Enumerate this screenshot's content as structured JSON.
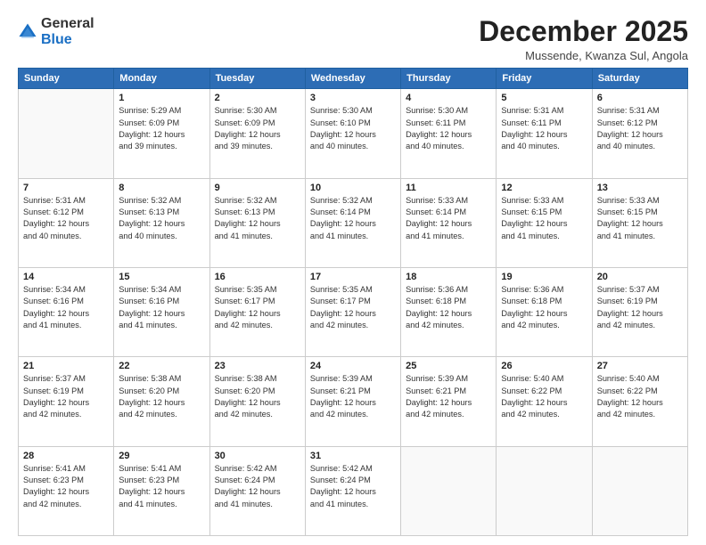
{
  "logo": {
    "general": "General",
    "blue": "Blue"
  },
  "header": {
    "month": "December 2025",
    "location": "Mussende, Kwanza Sul, Angola"
  },
  "days_of_week": [
    "Sunday",
    "Monday",
    "Tuesday",
    "Wednesday",
    "Thursday",
    "Friday",
    "Saturday"
  ],
  "weeks": [
    [
      {
        "day": "",
        "info": ""
      },
      {
        "day": "1",
        "info": "Sunrise: 5:29 AM\nSunset: 6:09 PM\nDaylight: 12 hours\nand 39 minutes."
      },
      {
        "day": "2",
        "info": "Sunrise: 5:30 AM\nSunset: 6:09 PM\nDaylight: 12 hours\nand 39 minutes."
      },
      {
        "day": "3",
        "info": "Sunrise: 5:30 AM\nSunset: 6:10 PM\nDaylight: 12 hours\nand 40 minutes."
      },
      {
        "day": "4",
        "info": "Sunrise: 5:30 AM\nSunset: 6:11 PM\nDaylight: 12 hours\nand 40 minutes."
      },
      {
        "day": "5",
        "info": "Sunrise: 5:31 AM\nSunset: 6:11 PM\nDaylight: 12 hours\nand 40 minutes."
      },
      {
        "day": "6",
        "info": "Sunrise: 5:31 AM\nSunset: 6:12 PM\nDaylight: 12 hours\nand 40 minutes."
      }
    ],
    [
      {
        "day": "7",
        "info": "Sunrise: 5:31 AM\nSunset: 6:12 PM\nDaylight: 12 hours\nand 40 minutes."
      },
      {
        "day": "8",
        "info": "Sunrise: 5:32 AM\nSunset: 6:13 PM\nDaylight: 12 hours\nand 40 minutes."
      },
      {
        "day": "9",
        "info": "Sunrise: 5:32 AM\nSunset: 6:13 PM\nDaylight: 12 hours\nand 41 minutes."
      },
      {
        "day": "10",
        "info": "Sunrise: 5:32 AM\nSunset: 6:14 PM\nDaylight: 12 hours\nand 41 minutes."
      },
      {
        "day": "11",
        "info": "Sunrise: 5:33 AM\nSunset: 6:14 PM\nDaylight: 12 hours\nand 41 minutes."
      },
      {
        "day": "12",
        "info": "Sunrise: 5:33 AM\nSunset: 6:15 PM\nDaylight: 12 hours\nand 41 minutes."
      },
      {
        "day": "13",
        "info": "Sunrise: 5:33 AM\nSunset: 6:15 PM\nDaylight: 12 hours\nand 41 minutes."
      }
    ],
    [
      {
        "day": "14",
        "info": "Sunrise: 5:34 AM\nSunset: 6:16 PM\nDaylight: 12 hours\nand 41 minutes."
      },
      {
        "day": "15",
        "info": "Sunrise: 5:34 AM\nSunset: 6:16 PM\nDaylight: 12 hours\nand 41 minutes."
      },
      {
        "day": "16",
        "info": "Sunrise: 5:35 AM\nSunset: 6:17 PM\nDaylight: 12 hours\nand 42 minutes."
      },
      {
        "day": "17",
        "info": "Sunrise: 5:35 AM\nSunset: 6:17 PM\nDaylight: 12 hours\nand 42 minutes."
      },
      {
        "day": "18",
        "info": "Sunrise: 5:36 AM\nSunset: 6:18 PM\nDaylight: 12 hours\nand 42 minutes."
      },
      {
        "day": "19",
        "info": "Sunrise: 5:36 AM\nSunset: 6:18 PM\nDaylight: 12 hours\nand 42 minutes."
      },
      {
        "day": "20",
        "info": "Sunrise: 5:37 AM\nSunset: 6:19 PM\nDaylight: 12 hours\nand 42 minutes."
      }
    ],
    [
      {
        "day": "21",
        "info": "Sunrise: 5:37 AM\nSunset: 6:19 PM\nDaylight: 12 hours\nand 42 minutes."
      },
      {
        "day": "22",
        "info": "Sunrise: 5:38 AM\nSunset: 6:20 PM\nDaylight: 12 hours\nand 42 minutes."
      },
      {
        "day": "23",
        "info": "Sunrise: 5:38 AM\nSunset: 6:20 PM\nDaylight: 12 hours\nand 42 minutes."
      },
      {
        "day": "24",
        "info": "Sunrise: 5:39 AM\nSunset: 6:21 PM\nDaylight: 12 hours\nand 42 minutes."
      },
      {
        "day": "25",
        "info": "Sunrise: 5:39 AM\nSunset: 6:21 PM\nDaylight: 12 hours\nand 42 minutes."
      },
      {
        "day": "26",
        "info": "Sunrise: 5:40 AM\nSunset: 6:22 PM\nDaylight: 12 hours\nand 42 minutes."
      },
      {
        "day": "27",
        "info": "Sunrise: 5:40 AM\nSunset: 6:22 PM\nDaylight: 12 hours\nand 42 minutes."
      }
    ],
    [
      {
        "day": "28",
        "info": "Sunrise: 5:41 AM\nSunset: 6:23 PM\nDaylight: 12 hours\nand 42 minutes."
      },
      {
        "day": "29",
        "info": "Sunrise: 5:41 AM\nSunset: 6:23 PM\nDaylight: 12 hours\nand 41 minutes."
      },
      {
        "day": "30",
        "info": "Sunrise: 5:42 AM\nSunset: 6:24 PM\nDaylight: 12 hours\nand 41 minutes."
      },
      {
        "day": "31",
        "info": "Sunrise: 5:42 AM\nSunset: 6:24 PM\nDaylight: 12 hours\nand 41 minutes."
      },
      {
        "day": "",
        "info": ""
      },
      {
        "day": "",
        "info": ""
      },
      {
        "day": "",
        "info": ""
      }
    ]
  ]
}
